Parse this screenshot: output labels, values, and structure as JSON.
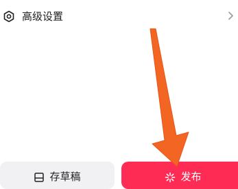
{
  "settings": {
    "label": "高级设置",
    "icon": "settings-hexagon-icon",
    "chevron_icon": "chevron-right-icon"
  },
  "bottom_bar": {
    "draft_label": "存草稿",
    "draft_icon": "draft-box-icon",
    "publish_label": "发布",
    "publish_icon": "sparkle-icon"
  },
  "colors": {
    "publish_background": "#fe2c55",
    "draft_background": "#f1f1f3",
    "annotation_arrow": "#f26522"
  }
}
